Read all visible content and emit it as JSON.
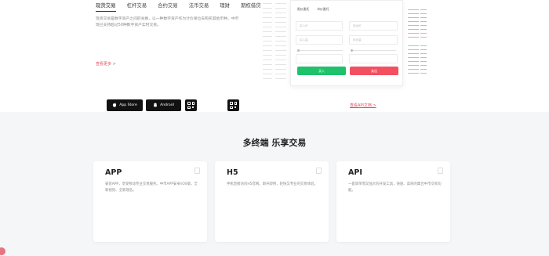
{
  "tabs": [
    {
      "label": "现货交易",
      "active": true
    },
    {
      "label": "杠杆交易",
      "active": false
    },
    {
      "label": "合约交易",
      "active": false
    },
    {
      "label": "法币交易",
      "active": false
    },
    {
      "label": "理财",
      "active": false
    },
    {
      "label": "期权借贷",
      "active": false
    }
  ],
  "spot": {
    "description": "现货交易是数字资产之间的兑换，以一种数字资产作为计价单位去购买其他币种，中币现已支持超过50种数字资产实时交易。",
    "more_label": "查看更多 >"
  },
  "trade_panel": {
    "tabs": [
      "限价委托",
      "市价委托"
    ],
    "inputs": [
      "买入价",
      "买入量",
      "卖出价",
      "卖出量"
    ],
    "buy_label": "买入",
    "sell_label": "卖出"
  },
  "section": {
    "title": "多终端 乐享交易"
  },
  "cards": [
    {
      "title": "APP",
      "desc": "安装APP，享受移动专业交易服务。中币APP安卓/iOS版，全新视觉、全新理念。"
    },
    {
      "title": "H5",
      "desc": "手机直接访问H5官网，即开即用，轻快又专业的交易体验。"
    },
    {
      "title": "API",
      "desc": "一套简单而又强大的开发工具，快速、高效的集合中币交易功能。"
    }
  ],
  "app_buttons": {
    "app_store": "App Store",
    "android": "Android"
  },
  "api_link": "查看API文档 >",
  "colors": {
    "buy": "#1fc16b",
    "sell": "#f25061",
    "link": "#e8485b"
  }
}
